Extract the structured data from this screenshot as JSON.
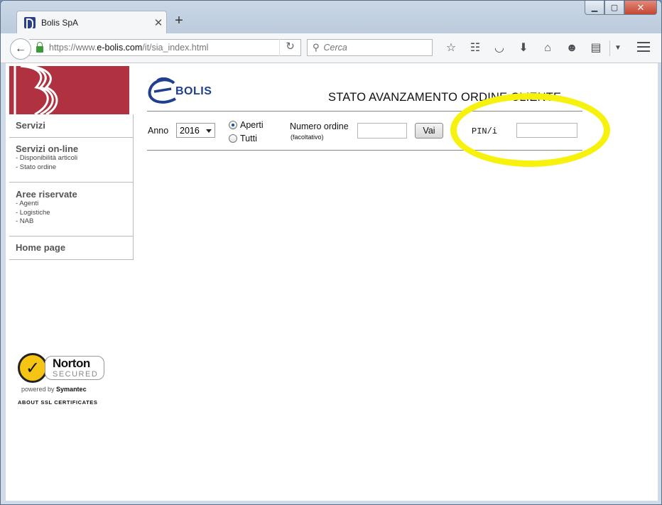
{
  "browser": {
    "tab_title": "Bolis SpA",
    "url_prefix": "https://www.",
    "url_domain": "e-bolis.com",
    "url_path": "/it/sia_index.html",
    "search_placeholder": "Cerca",
    "window_controls": [
      "minimize-icon",
      "maximize-icon",
      "close-icon"
    ],
    "toolbar_icons": [
      "star-icon",
      "reader-list-icon",
      "pocket-icon",
      "download-icon",
      "home-icon",
      "chat-icon",
      "pdf-icon",
      "dropdown-icon"
    ]
  },
  "sidebar": {
    "servizi": "Servizi",
    "online_title": "Servizi on-line",
    "online_items": [
      "- Disponibilità articoli",
      "- Stato ordine"
    ],
    "aree_title": "Aree riservate",
    "aree_items": [
      "- Agenti",
      "- Logistiche",
      "- NAB"
    ],
    "home": "Home page"
  },
  "norton": {
    "name": "Norton",
    "secured": "SECURED",
    "powered_prefix": "powered by",
    "powered_brand": "Symantec",
    "ssl": "ABOUT SSL CERTIFICATES"
  },
  "page": {
    "logo_text": "BOLIS",
    "title": "STATO AVANZAMENTO ORDINE CLIENTE",
    "anno_label": "Anno",
    "anno_value": "2016",
    "radio_aperti": "Aperti",
    "radio_tutti": "Tutti",
    "numero_label": "Numero ordine",
    "numero_sub": "(facoltativo)",
    "vai_label": "Vai",
    "pin_label": "PIN/i"
  },
  "colors": {
    "brand_red": "#b0313f",
    "brand_blue": "#1f3f8f",
    "highlight": "#f7f20d"
  }
}
